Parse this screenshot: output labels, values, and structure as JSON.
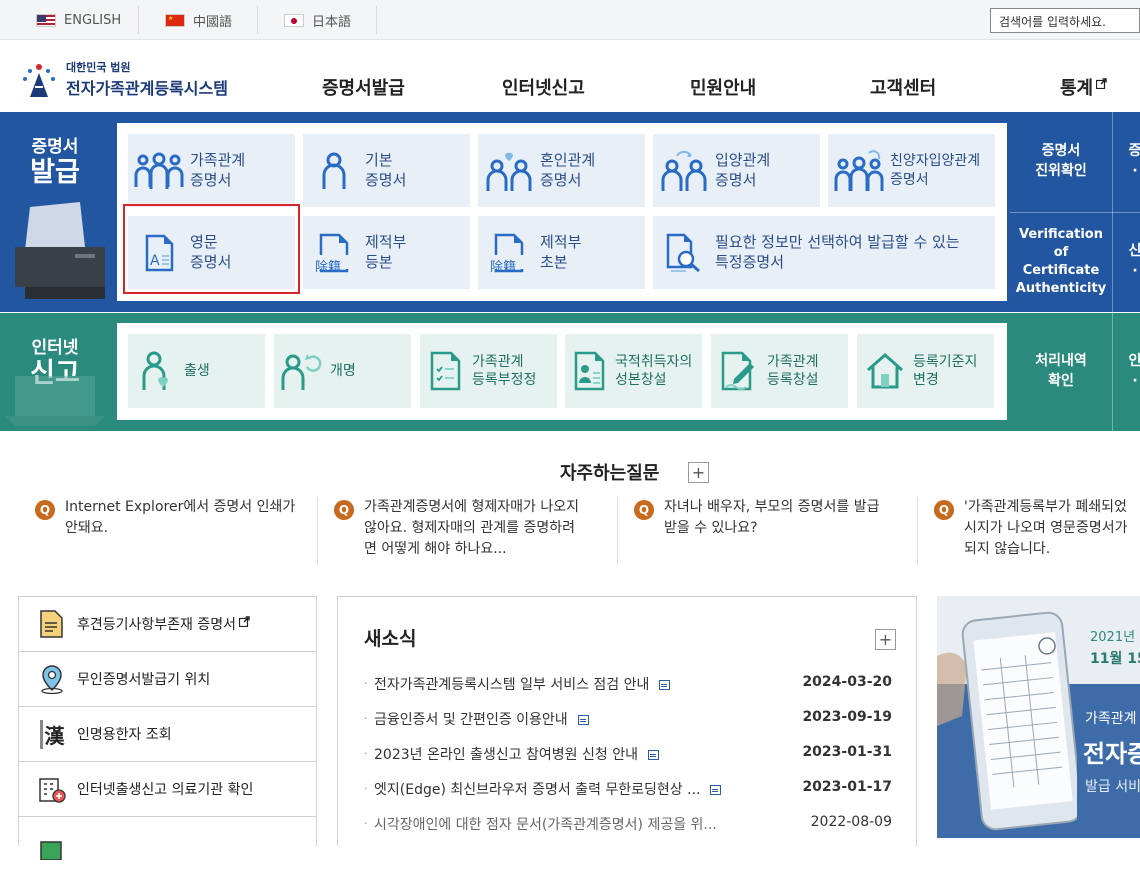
{
  "languages": [
    {
      "label": "ENGLISH",
      "flag": "us-flag-icon"
    },
    {
      "label": "中國語",
      "flag": "china-flag-icon"
    },
    {
      "label": "日本語",
      "flag": "japan-flag-icon"
    }
  ],
  "search": {
    "placeholder": "검색어를 입력하세요."
  },
  "logo": {
    "small": "대한민국 법원",
    "big": "전자가족관계등록시스템"
  },
  "gnb": [
    "증명서발급",
    "인터넷신고",
    "민원안내",
    "고객센터",
    "통계"
  ],
  "certificate": {
    "title_small": "증명서",
    "title_big": "발급",
    "cards": [
      {
        "label": "가족관계\n증명서",
        "icon": "family-icon"
      },
      {
        "label": "기본\n증명서",
        "icon": "person-icon"
      },
      {
        "label": "혼인관계\n증명서",
        "icon": "marriage-icon"
      },
      {
        "label": "입양관계\n증명서",
        "icon": "adoption-icon"
      },
      {
        "label": "친양자입양관계\n증명서",
        "icon": "full-adoption-icon"
      },
      {
        "label": "영문\n증명서",
        "icon": "english-document-icon"
      },
      {
        "label": "제적부\n등본",
        "icon": "removed-register-icon"
      },
      {
        "label": "제적부\n초본",
        "icon": "removed-register-icon"
      },
      {
        "label": "필요한 정보만 선택하여 발급할 수 있는\n특정증명서",
        "icon": "search-document-icon"
      }
    ],
    "side": [
      "증명서\n진위확인",
      "Verification of\nCertificate\nAuthenticity"
    ],
    "badge": "除籍"
  },
  "report": {
    "title_small": "인터넷",
    "title_big": "신고",
    "cards": [
      {
        "label": "출생",
        "icon": "birth-icon"
      },
      {
        "label": "개명",
        "icon": "rename-icon"
      },
      {
        "label": "가족관계\n등록부정정",
        "icon": "correction-icon"
      },
      {
        "label": "국적취득자의\n성본창설",
        "icon": "naturalization-icon"
      },
      {
        "label": "가족관계\n등록창설",
        "icon": "registration-icon"
      },
      {
        "label": "등록기준지\n변경",
        "icon": "house-icon"
      }
    ],
    "side": [
      "처리내역\n확인"
    ]
  },
  "faq": {
    "title": "자주하는질문",
    "items": [
      "Internet Explorer에서 증명서 인쇄가\n안돼요.",
      "가족관계증명서에 형제자매가 나오지\n않아요. 형제자매의 관계를 증명하려\n면 어떻게 해야 하나요...",
      "자녀나 배우자, 부모의 증명서를 발급\n받을 수 있나요?",
      "'가족관계등록부가 폐쇄되었\n시지가 나오며 영문증명서가\n되지 않습니다."
    ]
  },
  "quick": [
    {
      "label": "후견등기사항부존재 증명서",
      "icon": "document-icon",
      "external": "external-link-icon"
    },
    {
      "label": "무인증명서발급기 위치",
      "icon": "location-pin-icon"
    },
    {
      "label": "인명용한자 조회",
      "icon": "hanja-book-icon",
      "glyph": "漢"
    },
    {
      "label": "인터넷출생신고 의료기관 확인",
      "icon": "hospital-icon"
    },
    {
      "label": "",
      "icon": "green-document-icon"
    }
  ],
  "news": {
    "title": "새소식",
    "items": [
      {
        "title": "전자가족관계등록시스템 일부 서비스 점검 안내",
        "date": "2024-03-20"
      },
      {
        "title": "금융인증서 및 간편인증 이용안내",
        "date": "2023-09-19"
      },
      {
        "title": "2023년 온라인 출생신고 참여병원 신청 안내",
        "date": "2023-01-31"
      },
      {
        "title": "엣지(Edge) 최신브라우저 증명서 출력 무한로딩현상 ...",
        "date": "2023-01-17"
      },
      {
        "title": "시각장애인에 대한 점자 문서(가족관계증명서) 제공을 위...",
        "date": "2022-08-09"
      }
    ]
  },
  "banner": {
    "year": "2021년",
    "date": "11월 15",
    "line1": "가족관계",
    "line2": "전자증",
    "line3": "발급 서비"
  },
  "colors": {
    "blue_band": "#2256a0",
    "green_band": "#2a8a7d",
    "highlight": "#d9252a",
    "faq_badge": "#c86a1e"
  }
}
